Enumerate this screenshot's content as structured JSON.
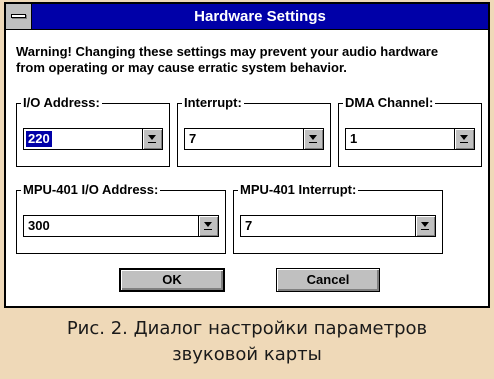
{
  "window": {
    "title": "Hardware Settings"
  },
  "warning": {
    "line1": "Warning!  Changing these settings may prevent your audio hardware",
    "line2": "from operating or may cause erratic system behavior."
  },
  "fields": {
    "io_address": {
      "label": "I/O Address:",
      "value": "220"
    },
    "interrupt": {
      "label": "Interrupt:",
      "value": "7"
    },
    "dma_channel": {
      "label": "DMA Channel:",
      "value": "1"
    },
    "mpu_io_address": {
      "label": "MPU-401 I/O Address:",
      "value": "300"
    },
    "mpu_interrupt": {
      "label": "MPU-401 Interrupt:",
      "value": "7"
    }
  },
  "buttons": {
    "ok": "OK",
    "cancel": "Cancel"
  },
  "caption": {
    "line1": "Рис. 2. Диалог настройки параметров",
    "line2": "звуковой карты"
  },
  "colors": {
    "titlebar": "#0000a8",
    "selection": "#0000a8",
    "button_face": "#c0c0c0",
    "page_background": "#efd9b8"
  }
}
